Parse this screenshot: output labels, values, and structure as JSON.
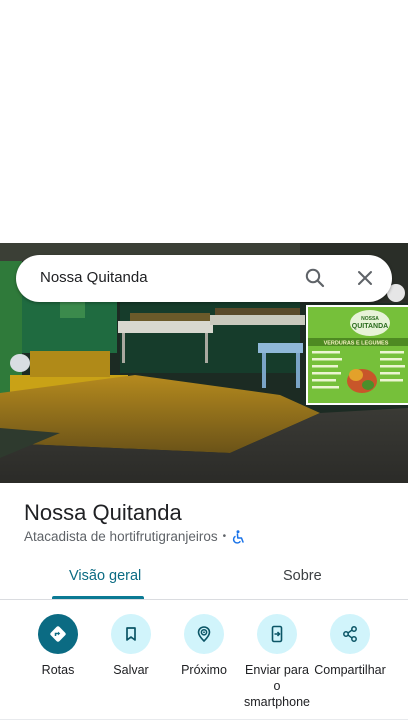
{
  "search": {
    "query": "Nossa Quitanda"
  },
  "place": {
    "name": "Nossa Quitanda",
    "category": "Atacadista de hortifrutigranjeiros",
    "separator": "•"
  },
  "tabs": [
    {
      "label": "Visão geral",
      "selected": true
    },
    {
      "label": "Sobre",
      "selected": false
    }
  ],
  "actions": [
    {
      "label": "Rotas",
      "icon": "directions-icon"
    },
    {
      "label": "Salvar",
      "icon": "bookmark-icon"
    },
    {
      "label": "Próximo",
      "icon": "nearby-icon"
    },
    {
      "label": "Enviar para o smartphone",
      "icon": "send-to-phone-icon"
    },
    {
      "label": "Compartilhar",
      "icon": "share-icon"
    }
  ],
  "photo": {
    "sign_title_top": "NOSSA",
    "sign_title_main": "QUITANDA",
    "sign_banner": "VERDURAS E LEGUMES"
  },
  "colors": {
    "accent": "#0b6b83",
    "accent_light": "#d1f4fb",
    "accessibility": "#1a73e8"
  }
}
